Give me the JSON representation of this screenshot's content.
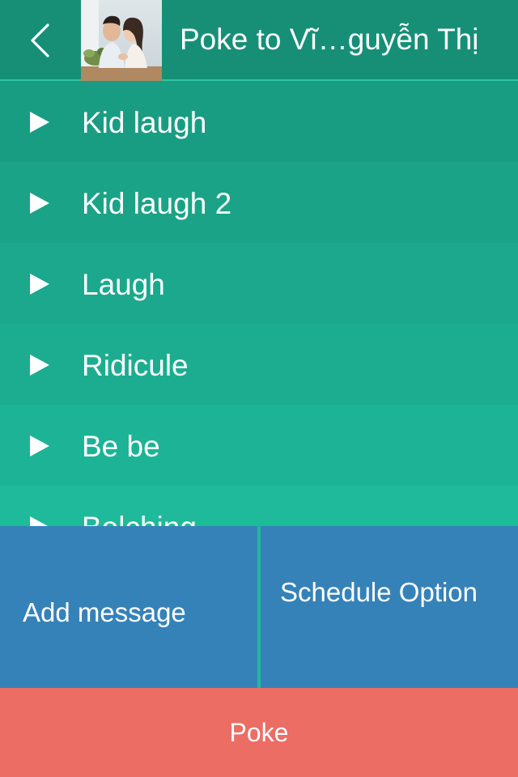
{
  "header": {
    "back_icon": "chevron-left-icon",
    "title": "Poke to Vĩ…guyễn Thị"
  },
  "sounds": [
    {
      "label": "Kid laugh",
      "bg": "#199d82"
    },
    {
      "label": "Kid laugh 2",
      "bg": "#1aa387"
    },
    {
      "label": "Laugh",
      "bg": "#1ba88c"
    },
    {
      "label": "Ridicule",
      "bg": "#1cad91"
    },
    {
      "label": "Be be",
      "bg": "#1db396"
    },
    {
      "label": "Belching",
      "bg": "#1fb99c"
    }
  ],
  "actions": {
    "add_message_label": "Add message",
    "schedule_label": "Schedule Option",
    "poke_label": "Poke"
  },
  "colors": {
    "header_bg": "#178f77",
    "action_blue": "#3582b9",
    "poke_red": "#ec6d63"
  }
}
